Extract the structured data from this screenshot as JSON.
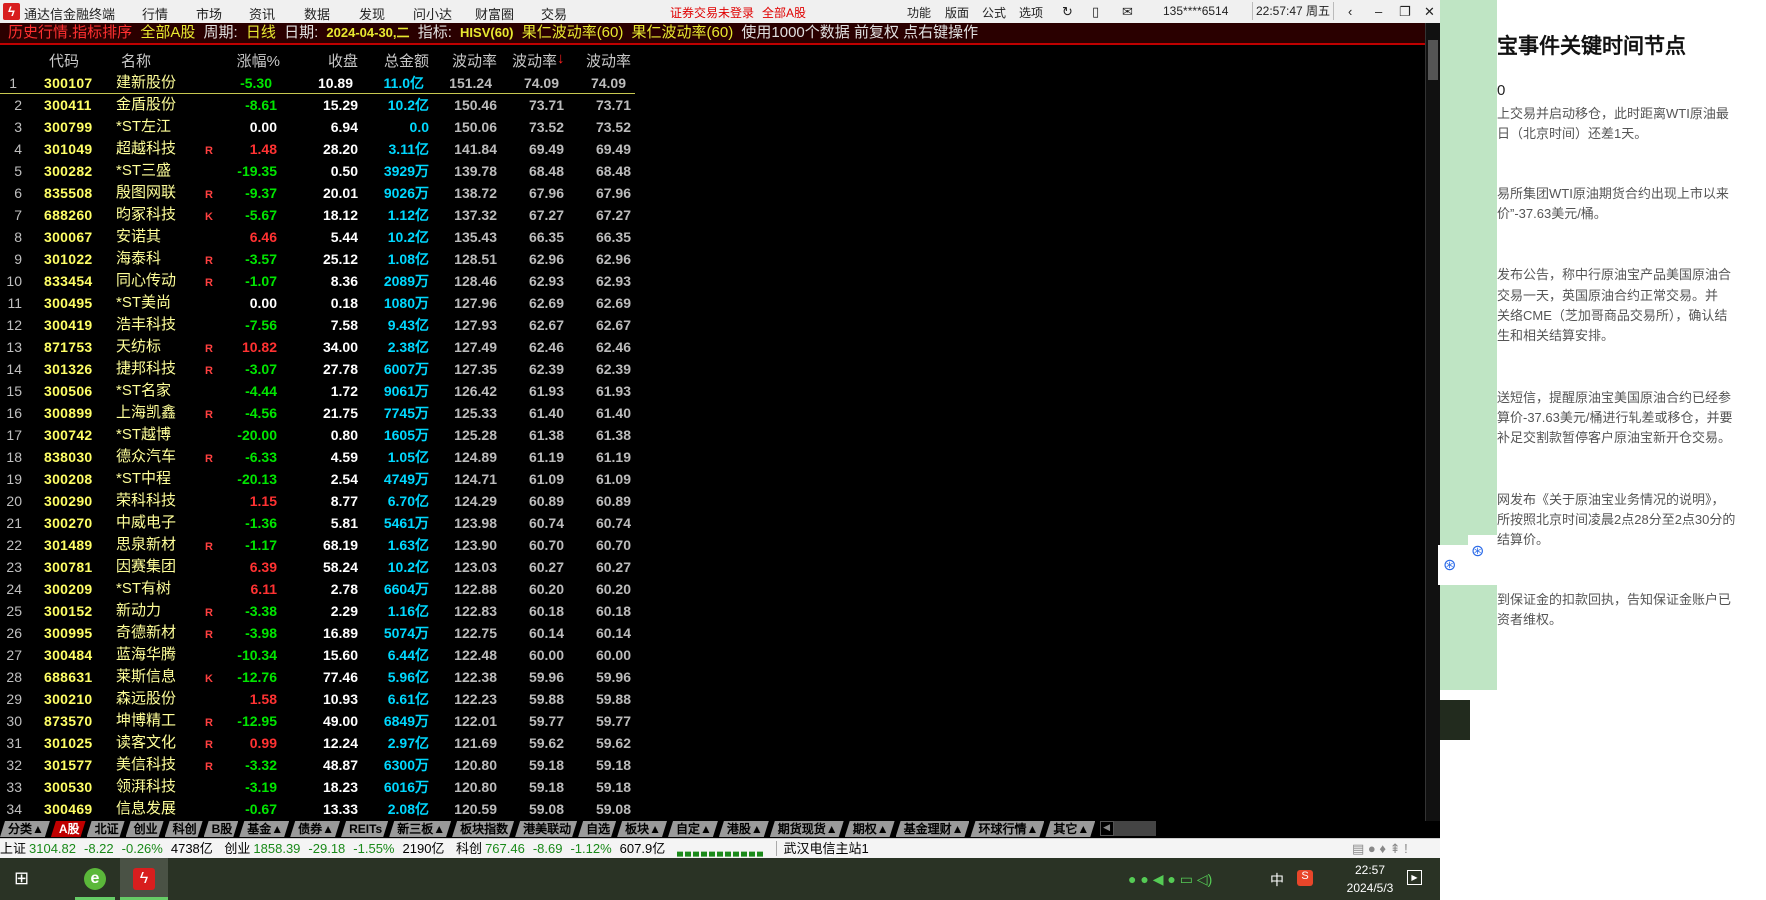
{
  "titlebar": {
    "app_name": "通达信金融终端",
    "menu": [
      "行情",
      "市场",
      "资讯",
      "数据",
      "发现",
      "问小达",
      "财富圈",
      "交易"
    ],
    "login_status": "证券交易未登录",
    "market": "全部A股",
    "right_menu": [
      "功能",
      "版面",
      "公式",
      "选项"
    ],
    "account": "135****6514",
    "clock": "22:57:47 周五"
  },
  "infobar": {
    "mode": "历史行情.指标排序",
    "market": "全部A股",
    "period_label": "周期:",
    "period": "日线",
    "date_label": "日期:",
    "date": "2024-04-30,二",
    "indicator_label": "指标:",
    "indicator": "HISV(60)",
    "ind2": "果仁波动率(60)",
    "ind3": "果仁波动率(60)",
    "note": "使用1000个数据 前复权 点右键操作"
  },
  "headers": {
    "code": "代码",
    "name": "名称",
    "chg": "涨幅%",
    "close": "收盘",
    "amount": "总金额",
    "v1": "波动率",
    "v2": "波动率",
    "v2_sort": "↓",
    "v3": "波动率"
  },
  "rows": [
    [
      "1",
      "300107",
      "建新股份",
      "",
      "-5.30",
      "10.89",
      "11.0亿",
      "151.24",
      "74.09",
      "74.09"
    ],
    [
      "2",
      "300411",
      "金盾股份",
      "",
      "-8.61",
      "15.29",
      "10.2亿",
      "150.46",
      "73.71",
      "73.71"
    ],
    [
      "3",
      "300799",
      "*ST左江",
      "",
      "0.00",
      "6.94",
      "0.0",
      "150.06",
      "73.52",
      "73.52"
    ],
    [
      "4",
      "301049",
      "超越科技",
      "R",
      "1.48",
      "28.20",
      "3.11亿",
      "141.84",
      "69.49",
      "69.49"
    ],
    [
      "5",
      "300282",
      "*ST三盛",
      "",
      "-19.35",
      "0.50",
      "3929万",
      "139.78",
      "68.48",
      "68.48"
    ],
    [
      "6",
      "835508",
      "殷图网联",
      "R",
      "-9.37",
      "20.01",
      "9026万",
      "138.72",
      "67.96",
      "67.96"
    ],
    [
      "7",
      "688260",
      "昀冢科技",
      "K",
      "-5.67",
      "18.12",
      "1.12亿",
      "137.32",
      "67.27",
      "67.27"
    ],
    [
      "8",
      "300067",
      "安诺其",
      "",
      "6.46",
      "5.44",
      "10.2亿",
      "135.43",
      "66.35",
      "66.35"
    ],
    [
      "9",
      "301022",
      "海泰科",
      "R",
      "-3.57",
      "25.12",
      "1.08亿",
      "128.51",
      "62.96",
      "62.96"
    ],
    [
      "10",
      "833454",
      "同心传动",
      "R",
      "-1.07",
      "8.36",
      "2089万",
      "128.46",
      "62.93",
      "62.93"
    ],
    [
      "11",
      "300495",
      "*ST美尚",
      "",
      "0.00",
      "0.18",
      "1080万",
      "127.96",
      "62.69",
      "62.69"
    ],
    [
      "12",
      "300419",
      "浩丰科技",
      "",
      "-7.56",
      "7.58",
      "9.43亿",
      "127.93",
      "62.67",
      "62.67"
    ],
    [
      "13",
      "871753",
      "天纺标",
      "R",
      "10.82",
      "34.00",
      "2.38亿",
      "127.49",
      "62.46",
      "62.46"
    ],
    [
      "14",
      "301326",
      "捷邦科技",
      "R",
      "-3.07",
      "27.78",
      "6007万",
      "127.35",
      "62.39",
      "62.39"
    ],
    [
      "15",
      "300506",
      "*ST名家",
      "",
      "-4.44",
      "1.72",
      "9061万",
      "126.42",
      "61.93",
      "61.93"
    ],
    [
      "16",
      "300899",
      "上海凯鑫",
      "R",
      "-4.56",
      "21.75",
      "7745万",
      "125.33",
      "61.40",
      "61.40"
    ],
    [
      "17",
      "300742",
      "*ST越博",
      "",
      "-20.00",
      "0.80",
      "1605万",
      "125.28",
      "61.38",
      "61.38"
    ],
    [
      "18",
      "838030",
      "德众汽车",
      "R",
      "-6.33",
      "4.59",
      "1.05亿",
      "124.89",
      "61.19",
      "61.19"
    ],
    [
      "19",
      "300208",
      "*ST中程",
      "",
      "-20.13",
      "2.54",
      "4749万",
      "124.71",
      "61.09",
      "61.09"
    ],
    [
      "20",
      "300290",
      "荣科科技",
      "",
      "1.15",
      "8.77",
      "6.70亿",
      "124.29",
      "60.89",
      "60.89"
    ],
    [
      "21",
      "300270",
      "中威电子",
      "",
      "-1.36",
      "5.81",
      "5461万",
      "123.98",
      "60.74",
      "60.74"
    ],
    [
      "22",
      "301489",
      "思泉新材",
      "R",
      "-1.17",
      "68.19",
      "1.63亿",
      "123.90",
      "60.70",
      "60.70"
    ],
    [
      "23",
      "300781",
      "因赛集团",
      "",
      "6.39",
      "58.24",
      "10.2亿",
      "123.03",
      "60.27",
      "60.27"
    ],
    [
      "24",
      "300209",
      "*ST有树",
      "",
      "6.11",
      "2.78",
      "6604万",
      "122.88",
      "60.20",
      "60.20"
    ],
    [
      "25",
      "300152",
      "新动力",
      "R",
      "-3.38",
      "2.29",
      "1.16亿",
      "122.83",
      "60.18",
      "60.18"
    ],
    [
      "26",
      "300995",
      "奇德新材",
      "R",
      "-3.98",
      "16.89",
      "5074万",
      "122.75",
      "60.14",
      "60.14"
    ],
    [
      "27",
      "300484",
      "蓝海华腾",
      "",
      "-10.34",
      "15.60",
      "6.44亿",
      "122.48",
      "60.00",
      "60.00"
    ],
    [
      "28",
      "688631",
      "莱斯信息",
      "K",
      "-12.76",
      "77.46",
      "5.96亿",
      "122.38",
      "59.96",
      "59.96"
    ],
    [
      "29",
      "300210",
      "森远股份",
      "",
      "1.58",
      "10.93",
      "6.61亿",
      "122.23",
      "59.88",
      "59.88"
    ],
    [
      "30",
      "873570",
      "坤博精工",
      "R",
      "-12.95",
      "49.00",
      "6849万",
      "122.01",
      "59.77",
      "59.77"
    ],
    [
      "31",
      "301025",
      "读客文化",
      "R",
      "0.99",
      "12.24",
      "2.97亿",
      "121.69",
      "59.62",
      "59.62"
    ],
    [
      "32",
      "301577",
      "美信科技",
      "R",
      "-3.32",
      "48.87",
      "6300万",
      "120.80",
      "59.18",
      "59.18"
    ],
    [
      "33",
      "300530",
      "领湃科技",
      "",
      "-3.19",
      "18.23",
      "6016万",
      "120.80",
      "59.18",
      "59.18"
    ],
    [
      "34",
      "300469",
      "信息发展",
      "",
      "-0.67",
      "13.33",
      "2.08亿",
      "120.59",
      "59.08",
      "59.08"
    ]
  ],
  "tabs": [
    "分类▲",
    "A股",
    "北证",
    "创业",
    "科创",
    "B股",
    "基金▲",
    "债券▲",
    "REITs",
    "新三板▲",
    "板块指数",
    "港美联动",
    "自选",
    "板块▲",
    "自定▲",
    "港股▲",
    "期货现货▲",
    "期权▲",
    "基金理财▲",
    "环球行情▲",
    "其它▲"
  ],
  "status": {
    "sh_label": "上证",
    "sh_val": "3104.82",
    "sh_chg": "-8.22",
    "sh_pct": "-0.26%",
    "sh_amt": "4738亿",
    "cy_label": "创业",
    "cy_val": "1858.39",
    "cy_chg": "-29.18",
    "cy_pct": "-1.55%",
    "cy_amt": "2190亿",
    "kc_label": "科创",
    "kc_val": "767.46",
    "kc_chg": "-8.69",
    "kc_pct": "-1.12%",
    "kc_amt": "607.9亿",
    "server": "武汉电信主站1"
  },
  "taskbar": {
    "time": "22:57",
    "date": "2024/5/3",
    "ime": "中"
  },
  "article": {
    "title": "宝事件关键时间节点",
    "lines": [
      "0",
      "上交易并启动移仓，此时距离WTI原油最",
      "日（北京时间）还差1天。",
      "易所集团WTI原油期货合约出现上市以来",
      "价”-37.63美元/桶。",
      "发布公告，称中行原油宝产品美国原油合",
      "交易一天，英国原油合约正常交易。并",
      "关络CME（芝加哥商品交易所），确认结",
      "生和相关结算安排。",
      "送短信，提醒原油宝美国原油合约已经参",
      "算价-37.63美元/桶进行轧差或移仓，并要",
      "补足交割款暂停客户原油宝新开仓交易。",
      "网发布《关于原油宝业务情况的说明》，",
      "所按照北京时间凌晨2点28分至2点30分的",
      "结算价。",
      "到保证金的扣款回执，告知保证金账户已",
      "资者维权。"
    ]
  },
  "colors": {
    "up": "#ff3232",
    "down": "#00e600",
    "flat": "#ffffff",
    "code": "#ffff66",
    "amount": "#00d8ff",
    "bg": "#000000"
  }
}
